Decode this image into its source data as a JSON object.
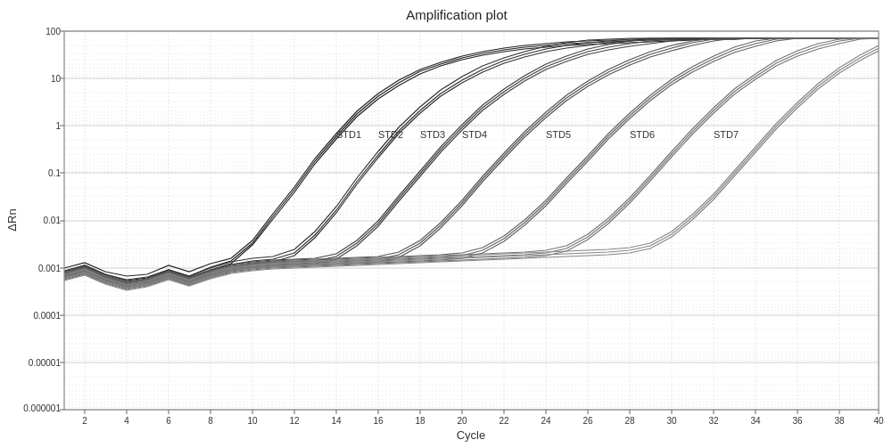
{
  "chart": {
    "title": "Amplification plot",
    "xAxis": {
      "label": "Cycle",
      "ticks": [
        2,
        4,
        6,
        8,
        10,
        12,
        14,
        16,
        18,
        20,
        22,
        24,
        26,
        28,
        30,
        32,
        34,
        36,
        38,
        40
      ]
    },
    "yAxis": {
      "label": "ΔRn",
      "ticks": [
        "100",
        "10",
        "1",
        "0.1",
        "0.01",
        "0.001",
        "0.0001",
        "0.00001",
        "0.000001"
      ]
    },
    "annotations": [
      "STD1",
      "STD2",
      "STD3",
      "STD4",
      "STD5",
      "STD6",
      "STD7"
    ]
  }
}
